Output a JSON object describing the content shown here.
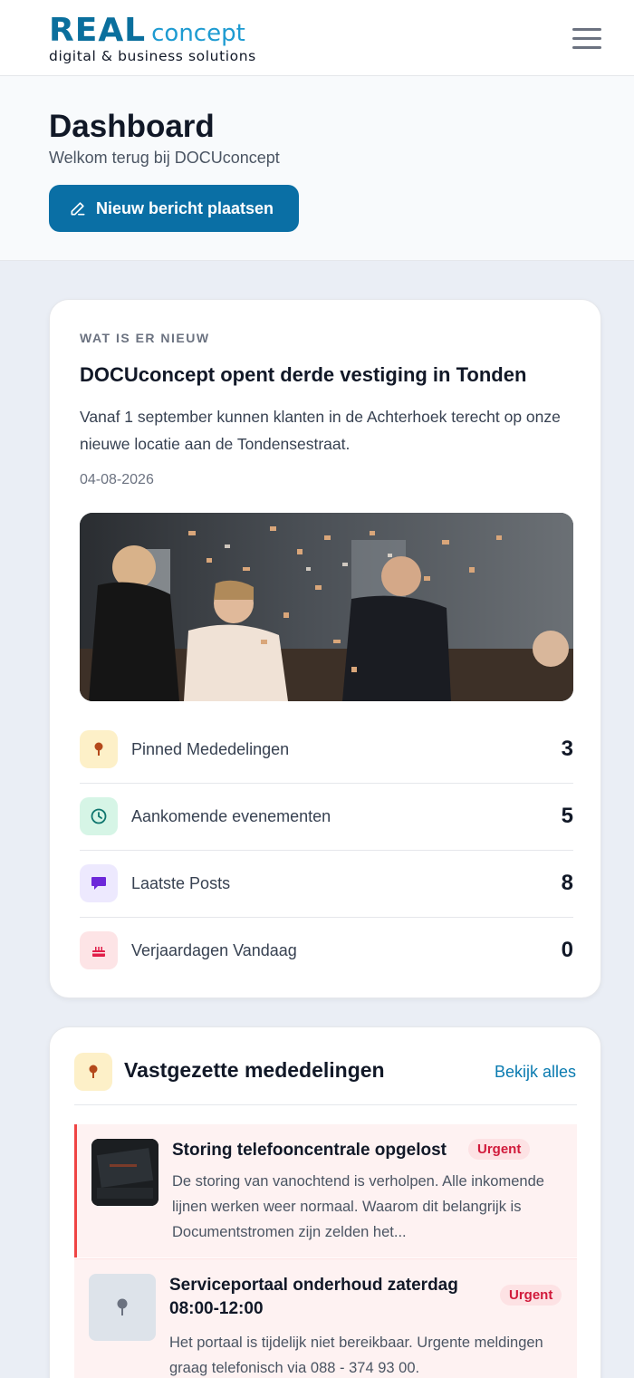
{
  "brand": {
    "logo_real": "REAL",
    "logo_concept": "concept",
    "logo_tagline": "digital & business solutions"
  },
  "nav": {
    "menu_icon": "hamburger-menu-icon"
  },
  "header": {
    "title": "Dashboard",
    "subtitle": "Welkom terug bij DOCUconcept",
    "new_post_label": "Nieuw bericht plaatsen",
    "new_post_icon": "pencil-icon"
  },
  "news": {
    "eyebrow": "WAT IS ER NIEUW",
    "title": "DOCUconcept opent derde vestiging in Tonden",
    "body": "Vanaf 1 september kunnen klanten in de Achterhoek terecht op onze nieuwe locatie aan de Tondensestraat.",
    "date": "04-08-2026",
    "image": "celebration-confetti-photo"
  },
  "stats": [
    {
      "label": "Pinned Mededelingen",
      "value": "3",
      "icon": "pin-icon",
      "color": "#fdf0c8"
    },
    {
      "label": "Aankomende evenementen",
      "value": "5",
      "icon": "clock-icon",
      "color": "#d6f5e6"
    },
    {
      "label": "Laatste Posts",
      "value": "8",
      "icon": "chat-bubble-icon",
      "color": "#ede9fe"
    },
    {
      "label": "Verjaardagen Vandaag",
      "value": "0",
      "icon": "cake-icon",
      "color": "#fde4e6"
    }
  ],
  "pinned": {
    "title": "Vastgezette mededelingen",
    "view_all": "Bekijk alles",
    "items": [
      {
        "title": "Storing telefooncentrale opgelost",
        "badge": "Urgent",
        "text": "De storing van vanochtend is verholpen. Alle inkomende lijnen werken weer normaal. Waarom dit belangrijk is Documentstromen zijn zelden het..."
      },
      {
        "title": "Serviceportaal onderhoud zaterdag 08:00-12:00",
        "badge": "Urgent",
        "text": "Het portaal is tijdelijk niet bereikbaar. Urgente meldingen graag telefonisch via 088 - 374 93 00."
      }
    ]
  },
  "colors": {
    "primary": "#0a6fa5",
    "logo_blue": "#0a6f9d",
    "accent": "#1e9bd1",
    "urgent_text": "#d11a3b",
    "urgent_bg": "#fde2e4"
  }
}
